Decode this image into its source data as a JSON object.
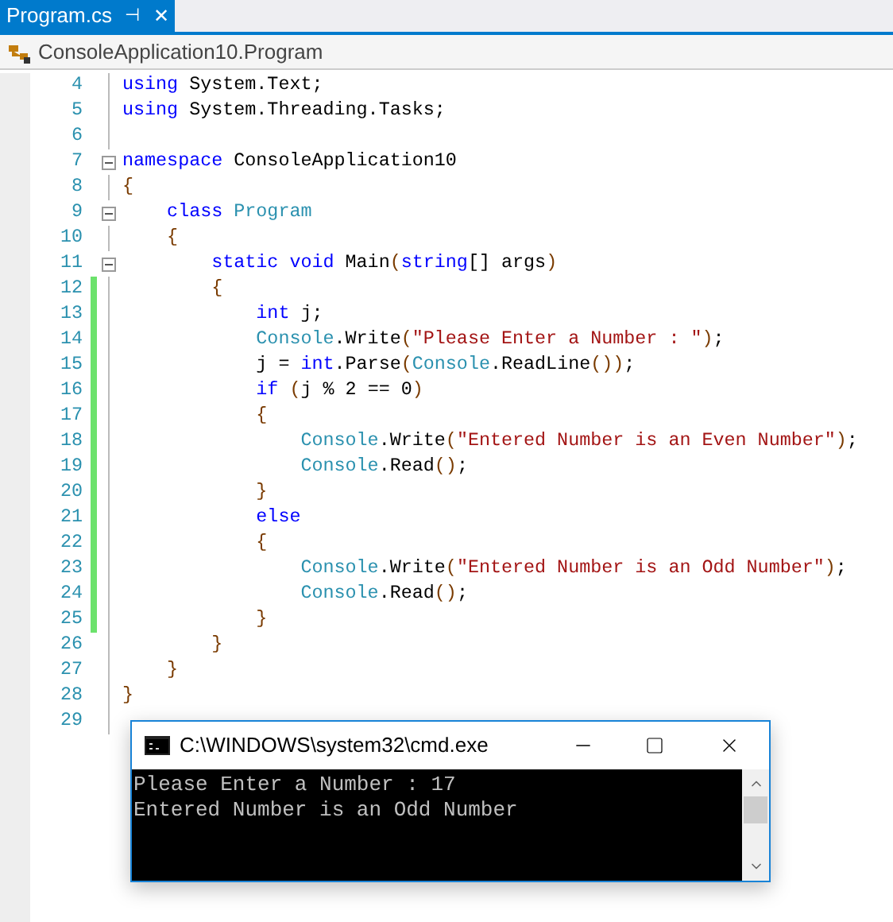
{
  "tab": {
    "title": "Program.cs",
    "pin": "⊣",
    "close": "✕",
    "selected": true
  },
  "navigation": {
    "path": "ConsoleApplication10.Program"
  },
  "lines": [
    {
      "number": "4",
      "changed": false,
      "fold": false,
      "tokens": [
        {
          "kind": "keyword",
          "text": "using"
        },
        {
          "kind": "plain",
          "text": " System.Text;"
        }
      ]
    },
    {
      "number": "5",
      "changed": false,
      "fold": false,
      "tokens": [
        {
          "kind": "keyword",
          "text": "using"
        },
        {
          "kind": "plain",
          "text": " System.Threading.Tasks;"
        }
      ]
    },
    {
      "number": "6",
      "changed": false,
      "fold": false
    },
    {
      "number": "7",
      "changed": false,
      "fold": true,
      "tokens": [
        {
          "kind": "keyword",
          "text": "namespace"
        },
        {
          "kind": "plain",
          "text": " ConsoleApplication10"
        }
      ]
    },
    {
      "number": "8",
      "changed": false,
      "fold": false,
      "tokens": [
        {
          "kind": "brace",
          "text": "{"
        }
      ]
    },
    {
      "number": "9",
      "changed": false,
      "fold": true,
      "tokens": [
        {
          "kind": "keyword",
          "text": "    class "
        },
        {
          "kind": "type",
          "text": "Program"
        }
      ]
    },
    {
      "number": "10",
      "changed": false,
      "fold": false,
      "tokens": [
        {
          "kind": "brace",
          "text": "    {"
        }
      ]
    },
    {
      "number": "11",
      "changed": false,
      "fold": true,
      "tokens": [
        {
          "kind": "keyword",
          "text": "        static void"
        },
        {
          "kind": "plain",
          "text": " Main"
        },
        {
          "kind": "brace",
          "text": "("
        },
        {
          "kind": "keyword",
          "text": "string"
        },
        {
          "kind": "plain",
          "text": "[] args"
        },
        {
          "kind": "brace",
          "text": ")"
        }
      ]
    },
    {
      "number": "12",
      "changed": true,
      "fold": false,
      "tokens": [
        {
          "kind": "brace",
          "text": "        {"
        }
      ]
    },
    {
      "number": "13",
      "changed": true,
      "fold": false,
      "tokens": [
        {
          "kind": "keyword",
          "text": "            int"
        },
        {
          "kind": "plain",
          "text": " j;"
        }
      ]
    },
    {
      "number": "14",
      "changed": true,
      "fold": false,
      "tokens": [
        {
          "kind": "type",
          "text": "            Console"
        },
        {
          "kind": "plain",
          "text": ".Write"
        },
        {
          "kind": "brace",
          "text": "("
        },
        {
          "kind": "string",
          "text": "\"Please Enter a Number : \""
        },
        {
          "kind": "brace",
          "text": ")"
        },
        {
          "kind": "plain",
          "text": ";"
        }
      ]
    },
    {
      "number": "15",
      "changed": true,
      "fold": false,
      "tokens": [
        {
          "kind": "plain",
          "text": "            j = "
        },
        {
          "kind": "keyword",
          "text": "int"
        },
        {
          "kind": "plain",
          "text": ".Parse"
        },
        {
          "kind": "brace",
          "text": "("
        },
        {
          "kind": "type",
          "text": "Console"
        },
        {
          "kind": "plain",
          "text": ".ReadLine"
        },
        {
          "kind": "brace",
          "text": "())"
        },
        {
          "kind": "plain",
          "text": ";"
        }
      ]
    },
    {
      "number": "16",
      "changed": true,
      "fold": false,
      "tokens": [
        {
          "kind": "keyword",
          "text": "            if "
        },
        {
          "kind": "brace",
          "text": "("
        },
        {
          "kind": "plain",
          "text": "j % 2 == 0"
        },
        {
          "kind": "brace",
          "text": ")"
        }
      ]
    },
    {
      "number": "17",
      "changed": true,
      "fold": false,
      "tokens": [
        {
          "kind": "brace",
          "text": "            {"
        }
      ]
    },
    {
      "number": "18",
      "changed": true,
      "fold": false,
      "tokens": [
        {
          "kind": "type",
          "text": "                Console"
        },
        {
          "kind": "plain",
          "text": ".Write"
        },
        {
          "kind": "brace",
          "text": "("
        },
        {
          "kind": "string",
          "text": "\"Entered Number is an Even Number\""
        },
        {
          "kind": "brace",
          "text": ")"
        },
        {
          "kind": "plain",
          "text": ";"
        }
      ]
    },
    {
      "number": "19",
      "changed": true,
      "fold": false,
      "tokens": [
        {
          "kind": "type",
          "text": "                Console"
        },
        {
          "kind": "plain",
          "text": ".Read"
        },
        {
          "kind": "brace",
          "text": "()"
        },
        {
          "kind": "plain",
          "text": ";"
        }
      ]
    },
    {
      "number": "20",
      "changed": true,
      "fold": false,
      "tokens": [
        {
          "kind": "brace",
          "text": "            }"
        }
      ]
    },
    {
      "number": "21",
      "changed": true,
      "fold": false,
      "tokens": [
        {
          "kind": "keyword",
          "text": "            else"
        }
      ]
    },
    {
      "number": "22",
      "changed": true,
      "fold": false,
      "tokens": [
        {
          "kind": "brace",
          "text": "            {"
        }
      ]
    },
    {
      "number": "23",
      "changed": true,
      "fold": false,
      "tokens": [
        {
          "kind": "type",
          "text": "                Console"
        },
        {
          "kind": "plain",
          "text": ".Write"
        },
        {
          "kind": "brace",
          "text": "("
        },
        {
          "kind": "string",
          "text": "\"Entered Number is an Odd Number\""
        },
        {
          "kind": "brace",
          "text": ")"
        },
        {
          "kind": "plain",
          "text": ";"
        }
      ]
    },
    {
      "number": "24",
      "changed": true,
      "fold": false,
      "tokens": [
        {
          "kind": "type",
          "text": "                Console"
        },
        {
          "kind": "plain",
          "text": ".Read"
        },
        {
          "kind": "brace",
          "text": "()"
        },
        {
          "kind": "plain",
          "text": ";"
        }
      ]
    },
    {
      "number": "25",
      "changed": true,
      "fold": false,
      "tokens": [
        {
          "kind": "brace",
          "text": "            }"
        }
      ]
    },
    {
      "number": "26",
      "changed": false,
      "fold": false,
      "tokens": [
        {
          "kind": "brace",
          "text": "        }"
        }
      ]
    },
    {
      "number": "27",
      "changed": false,
      "fold": false,
      "tokens": [
        {
          "kind": "brace",
          "text": "    }"
        }
      ]
    },
    {
      "number": "28",
      "changed": false,
      "fold": false,
      "tokens": [
        {
          "kind": "brace",
          "text": "}"
        }
      ]
    },
    {
      "number": "29",
      "changed": false,
      "fold": false
    }
  ],
  "console": {
    "title": "C:\\WINDOWS\\system32\\cmd.exe",
    "output": [
      "Please Enter a Number : 17",
      "Entered Number is an Odd Number"
    ]
  }
}
